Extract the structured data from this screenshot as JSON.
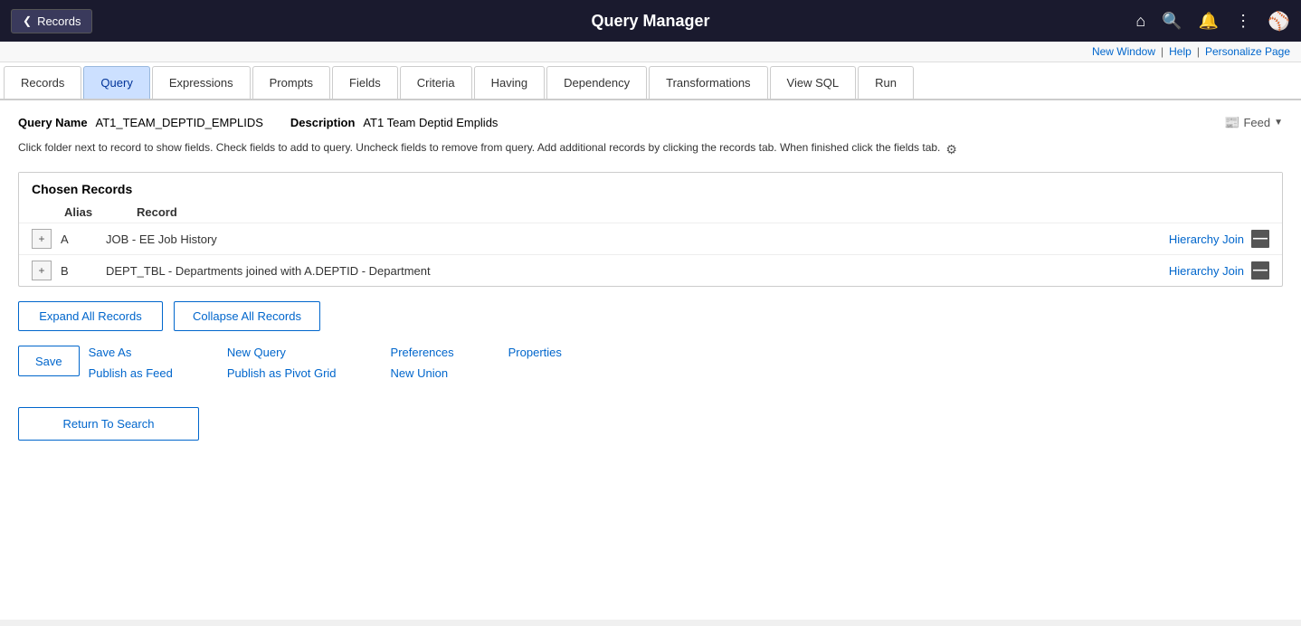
{
  "topbar": {
    "back_label": "Records",
    "title": "Query Manager"
  },
  "utility": {
    "new_window": "New Window",
    "help": "Help",
    "personalize": "Personalize Page"
  },
  "tabs": [
    {
      "id": "records",
      "label": "Records",
      "active": false
    },
    {
      "id": "query",
      "label": "Query",
      "active": true
    },
    {
      "id": "expressions",
      "label": "Expressions",
      "active": false
    },
    {
      "id": "prompts",
      "label": "Prompts",
      "active": false
    },
    {
      "id": "fields",
      "label": "Fields",
      "active": false
    },
    {
      "id": "criteria",
      "label": "Criteria",
      "active": false
    },
    {
      "id": "having",
      "label": "Having",
      "active": false
    },
    {
      "id": "dependency",
      "label": "Dependency",
      "active": false
    },
    {
      "id": "transformations",
      "label": "Transformations",
      "active": false
    },
    {
      "id": "view_sql",
      "label": "View SQL",
      "active": false
    },
    {
      "id": "run",
      "label": "Run",
      "active": false
    }
  ],
  "query": {
    "name_label": "Query Name",
    "name_value": "AT1_TEAM_DEPTID_EMPLIDS",
    "description_label": "Description",
    "description_value": "AT1 Team Deptid Emplids",
    "feed_label": "Feed"
  },
  "instructions": {
    "text": "Click folder next to record to show fields. Check fields to add to query. Uncheck fields to remove from query. Add additional records by clicking the records tab. When finished click the fields tab."
  },
  "chosen_records": {
    "title": "Chosen Records",
    "header_alias": "Alias",
    "header_record": "Record",
    "rows": [
      {
        "alias": "A",
        "record": "JOB - EE Job History",
        "hierarchy_join": "Hierarchy Join"
      },
      {
        "alias": "B",
        "record": "DEPT_TBL - Departments joined with A.DEPTID - Department",
        "hierarchy_join": "Hierarchy Join"
      }
    ]
  },
  "buttons": {
    "expand_all": "Expand All Records",
    "collapse_all": "Collapse All Records",
    "save": "Save",
    "save_as": "Save As",
    "new_query": "New Query",
    "preferences": "Preferences",
    "properties": "Properties",
    "publish_as_feed": "Publish as Feed",
    "publish_as_pivot": "Publish as Pivot Grid",
    "new_union": "New Union",
    "return_to_search": "Return To Search"
  }
}
